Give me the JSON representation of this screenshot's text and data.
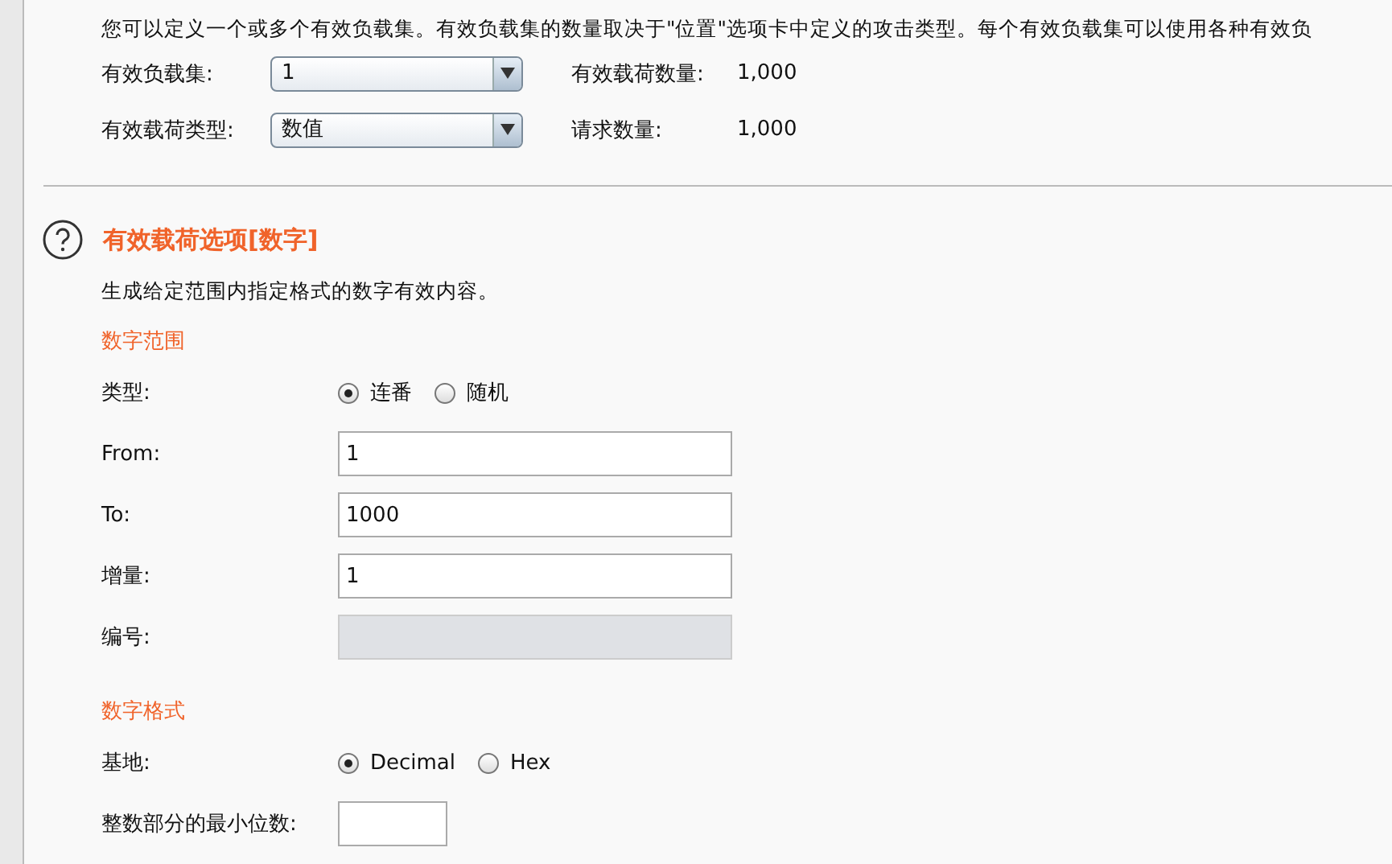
{
  "intro": "您可以定义一个或多个有效负载集。有效负载集的数量取决于\"位置\"选项卡中定义的攻击类型。每个有效负载集可以使用各种有效负",
  "payload_settings": [
    {
      "label": "有效负载集:",
      "value": "1",
      "info_label": "有效载荷数量:",
      "info_value": "1,000"
    },
    {
      "label": "有效载荷类型:",
      "value": "数值",
      "info_label": "请求数量:",
      "info_value": "1,000"
    }
  ],
  "options": {
    "title": "有效载荷选项[数字]",
    "description": "生成给定范围内指定格式的数字有效内容。",
    "sections": [
      {
        "heading": "数字范围",
        "rows": [
          {
            "kind": "radio",
            "label": "类型:",
            "choices": [
              {
                "label": "连番",
                "selected": true
              },
              {
                "label": "随机",
                "selected": false
              }
            ]
          },
          {
            "kind": "field",
            "label": "From:",
            "value": "1",
            "disabled": false
          },
          {
            "kind": "field",
            "label": "To:",
            "value": "1000",
            "disabled": false
          },
          {
            "kind": "field",
            "label": "增量:",
            "value": "1",
            "disabled": false
          },
          {
            "kind": "field",
            "label": "编号:",
            "disabled": true
          }
        ]
      },
      {
        "heading": "数字格式",
        "rows": [
          {
            "kind": "radio",
            "label": "基地:",
            "choices": [
              {
                "label": "Decimal",
                "selected": true
              },
              {
                "label": "Hex",
                "selected": false
              }
            ]
          },
          {
            "kind": "smallfield",
            "label": "整数部分的最小位数:",
            "disabled": false
          }
        ]
      }
    ]
  }
}
